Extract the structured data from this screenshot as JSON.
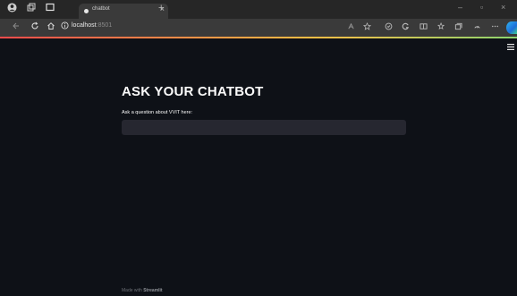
{
  "browser": {
    "tab": {
      "title": "chatbot",
      "close": "×"
    },
    "new_tab": "+",
    "window_controls": {
      "minimize": "–",
      "restore": "▫",
      "close": "×"
    },
    "address": {
      "host": "localhost",
      "port": ":8501"
    },
    "icons": [
      "profile-icon",
      "workspaces-icon",
      "tab-actions-icon",
      "back-icon",
      "refresh-icon",
      "home-icon",
      "info-icon",
      "read-aloud-icon",
      "favorite-icon",
      "tracking-icon",
      "extension-icon",
      "split-screen-icon",
      "favorites-icon",
      "collections-icon",
      "performance-icon",
      "more-icon",
      "edge-logo"
    ]
  },
  "app": {
    "title": "ASK YOUR CHATBOT",
    "question_label": "Ask a question about VVIT here:",
    "question_value": "",
    "footer_prefix": "Made with ",
    "footer_brand": "Streamlit"
  },
  "colors": {
    "page_bg": "#0e1117",
    "input_bg": "#262730",
    "text": "#fafafa",
    "accent_red": "#ff4b4b"
  }
}
